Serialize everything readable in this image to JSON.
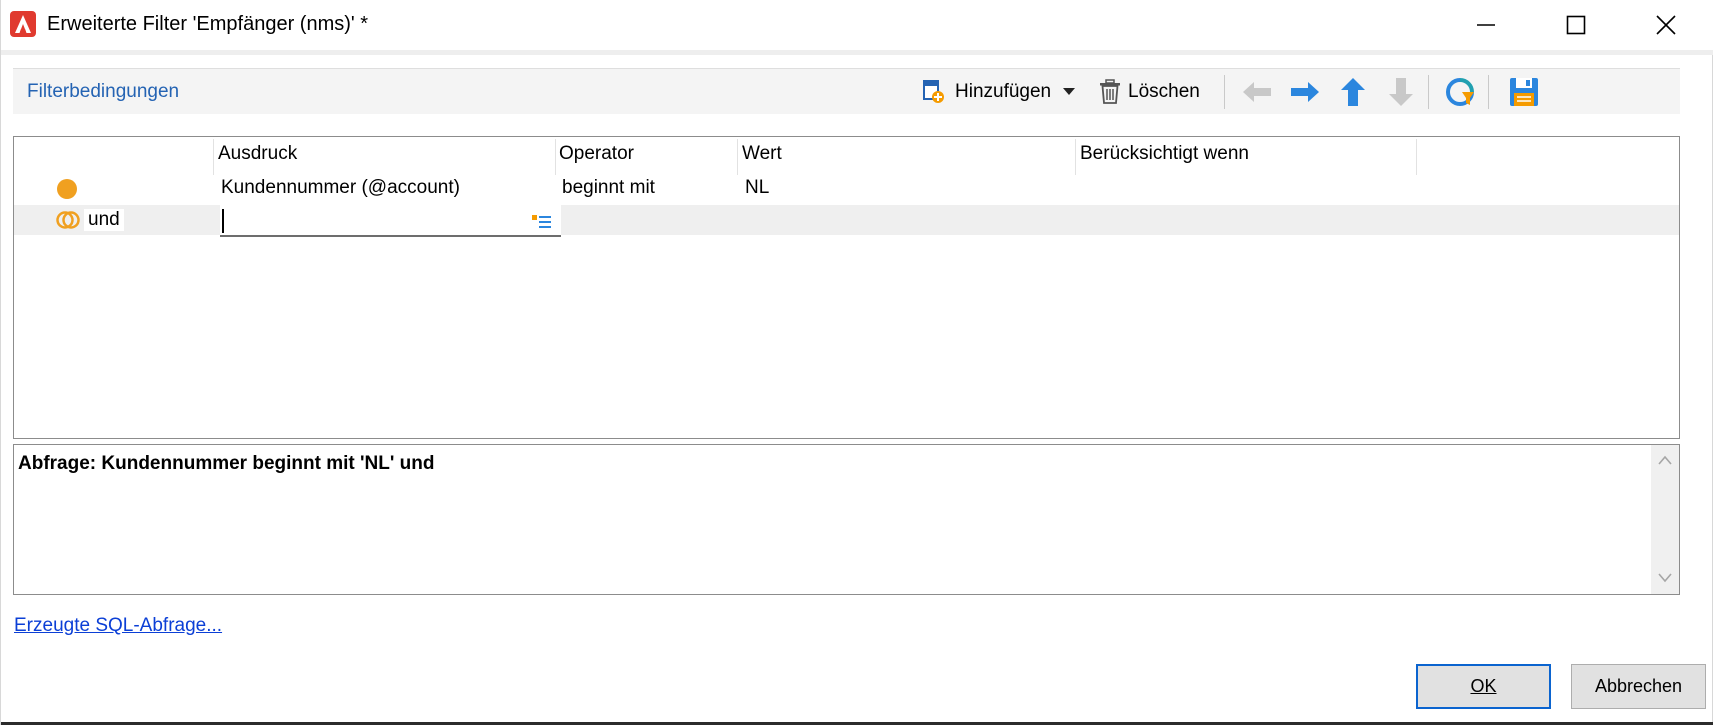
{
  "window": {
    "title": "Erweiterte Filter 'Empfänger (nms)' *"
  },
  "toolbar": {
    "section_title": "Filterbedingungen",
    "add_label": "Hinzufügen",
    "delete_label": "Löschen",
    "icons": [
      "add-condition-icon",
      "dropdown-arrow-icon",
      "trash-icon",
      "arrow-left-icon",
      "arrow-right-icon",
      "arrow-up-icon",
      "arrow-down-icon",
      "filter-refresh-icon",
      "save-icon"
    ]
  },
  "grid": {
    "columns": [
      "Ausdruck",
      "Operator",
      "Wert",
      "Berücksichtigt wenn"
    ],
    "rows": [
      {
        "connector": "",
        "expression": "Kundennummer (@account)",
        "operator": "beginnt mit",
        "value": "NL",
        "condition": ""
      },
      {
        "connector": "und",
        "expression": "",
        "operator": "",
        "value": "",
        "condition": ""
      }
    ]
  },
  "query": {
    "text": "Abfrage: Kundennummer beginnt mit 'NL' und"
  },
  "footer": {
    "sql_link": "Erzeugte SQL-Abfrage...",
    "ok_label": "OK",
    "cancel_label": "Abbrechen"
  },
  "colors": {
    "accent": "#2463b3",
    "link": "#0b3fd6",
    "bullet": "#f0a020",
    "app_icon": "#e03a2f"
  }
}
